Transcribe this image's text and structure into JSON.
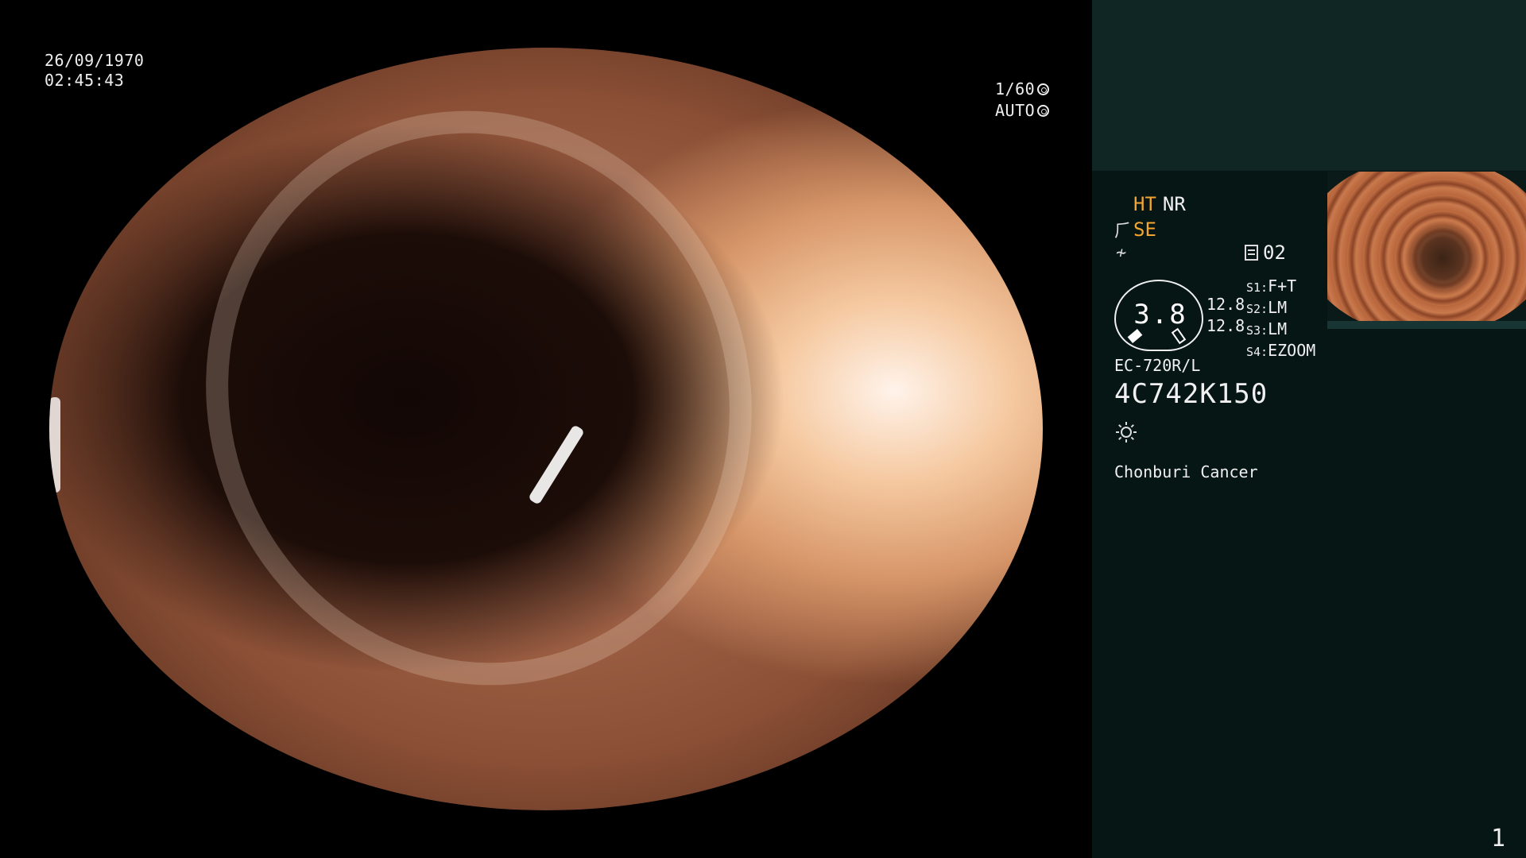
{
  "overlay": {
    "date": "26/09/1970",
    "time": "02:45:43",
    "shutter": "1/60",
    "iris_mode": "AUTO"
  },
  "panel": {
    "mode_ht": "HT",
    "mode_nr": "NR",
    "mode_se": "SE",
    "record_count": "02",
    "zoom_value": "3.8",
    "zoom_values": [
      "12.8",
      "12.8"
    ],
    "settings": [
      {
        "key": "S1:",
        "value": "F+T"
      },
      {
        "key": "S2:",
        "value": "LM"
      },
      {
        "key": "S3:",
        "value": "LM"
      },
      {
        "key": "S4:",
        "value": "EZOOM"
      }
    ],
    "scope_model": "EC-720R/L",
    "serial": "4C742K150",
    "hospital": "Chonburi Cancer",
    "page_number": "1"
  },
  "icons": {
    "shutter": "shutter-icon",
    "iris": "iris-icon",
    "filter": "filter-icon",
    "enhance": "enhance-icon",
    "record": "record-icon",
    "light": "light-icon"
  },
  "colors": {
    "accent": "#f2a531",
    "panel_bg": "#061614",
    "panel_top_bg": "#0f2625"
  }
}
